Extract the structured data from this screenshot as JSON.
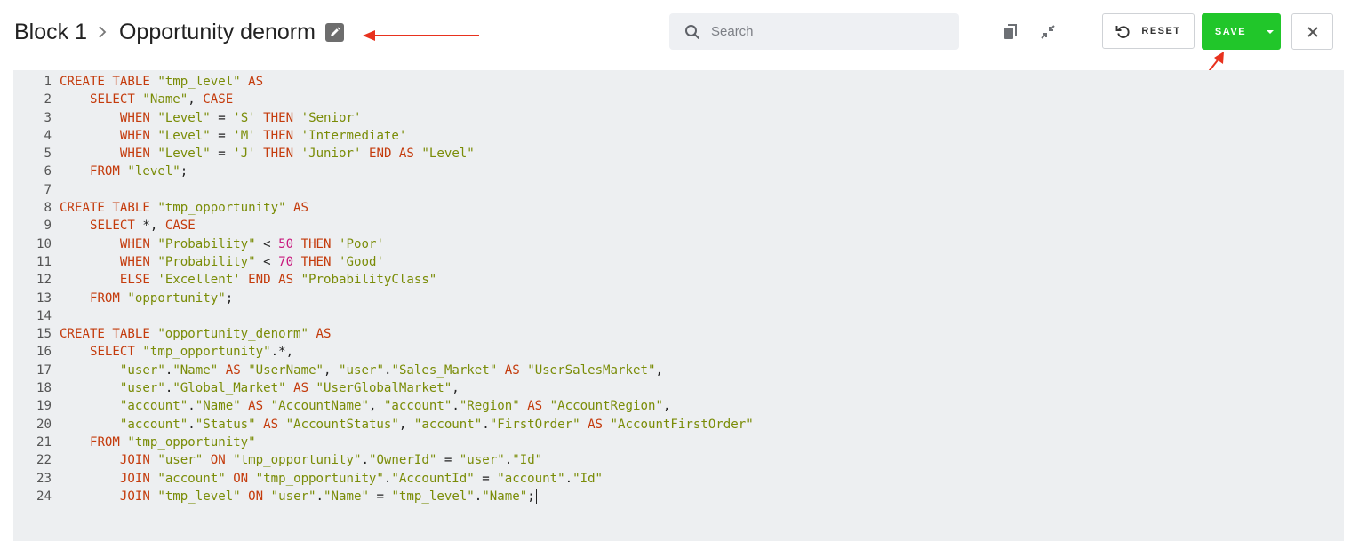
{
  "breadcrumb": {
    "parent": "Block 1",
    "separator": "›",
    "title": "Opportunity denorm"
  },
  "search": {
    "placeholder": "Search",
    "value": ""
  },
  "toolbar": {
    "reset_label": "RESET",
    "save_label": "SAVE"
  },
  "icons": {
    "edit": "pencil-icon",
    "search": "search-icon",
    "copy": "copy-icon",
    "collapse": "collapse-icon",
    "reset": "undo-icon",
    "dropdown": "caret-down-icon",
    "close": "close-icon"
  },
  "colors": {
    "save_green": "#21c62a",
    "keyword": "#c43b0c",
    "string": "#7a8c07",
    "number": "#c8187d",
    "annotation_arrow": "#e8321e",
    "editor_bg": "#edeff1"
  },
  "editor": {
    "lines": [
      [
        [
          "k",
          "CREATE TABLE "
        ],
        [
          "s",
          "\"tmp_level\""
        ],
        [
          "k",
          " AS"
        ]
      ],
      [
        [
          "t",
          "    "
        ],
        [
          "k",
          "SELECT "
        ],
        [
          "s",
          "\"Name\""
        ],
        [
          "t",
          ", "
        ],
        [
          "k",
          "CASE"
        ]
      ],
      [
        [
          "t",
          "        "
        ],
        [
          "k",
          "WHEN "
        ],
        [
          "s",
          "\"Level\""
        ],
        [
          "t",
          " = "
        ],
        [
          "s",
          "'S'"
        ],
        [
          "k",
          " THEN "
        ],
        [
          "s",
          "'Senior'"
        ]
      ],
      [
        [
          "t",
          "        "
        ],
        [
          "k",
          "WHEN "
        ],
        [
          "s",
          "\"Level\""
        ],
        [
          "t",
          " = "
        ],
        [
          "s",
          "'M'"
        ],
        [
          "k",
          " THEN "
        ],
        [
          "s",
          "'Intermediate'"
        ]
      ],
      [
        [
          "t",
          "        "
        ],
        [
          "k",
          "WHEN "
        ],
        [
          "s",
          "\"Level\""
        ],
        [
          "t",
          " = "
        ],
        [
          "s",
          "'J'"
        ],
        [
          "k",
          " THEN "
        ],
        [
          "s",
          "'Junior'"
        ],
        [
          "k",
          " END AS "
        ],
        [
          "s",
          "\"Level\""
        ]
      ],
      [
        [
          "t",
          "    "
        ],
        [
          "k",
          "FROM "
        ],
        [
          "s",
          "\"level\""
        ],
        [
          "t",
          ";"
        ]
      ],
      [],
      [
        [
          "k",
          "CREATE TABLE "
        ],
        [
          "s",
          "\"tmp_opportunity\""
        ],
        [
          "k",
          " AS"
        ]
      ],
      [
        [
          "t",
          "    "
        ],
        [
          "k",
          "SELECT "
        ],
        [
          "t",
          "*, "
        ],
        [
          "k",
          "CASE"
        ]
      ],
      [
        [
          "t",
          "        "
        ],
        [
          "k",
          "WHEN "
        ],
        [
          "s",
          "\"Probability\""
        ],
        [
          "t",
          " < "
        ],
        [
          "n",
          "50"
        ],
        [
          "k",
          " THEN "
        ],
        [
          "s",
          "'Poor'"
        ]
      ],
      [
        [
          "t",
          "        "
        ],
        [
          "k",
          "WHEN "
        ],
        [
          "s",
          "\"Probability\""
        ],
        [
          "t",
          " < "
        ],
        [
          "n",
          "70"
        ],
        [
          "k",
          " THEN "
        ],
        [
          "s",
          "'Good'"
        ]
      ],
      [
        [
          "t",
          "        "
        ],
        [
          "k",
          "ELSE "
        ],
        [
          "s",
          "'Excellent'"
        ],
        [
          "k",
          " END AS "
        ],
        [
          "s",
          "\"ProbabilityClass\""
        ]
      ],
      [
        [
          "t",
          "    "
        ],
        [
          "k",
          "FROM "
        ],
        [
          "s",
          "\"opportunity\""
        ],
        [
          "t",
          ";"
        ]
      ],
      [],
      [
        [
          "k",
          "CREATE TABLE "
        ],
        [
          "s",
          "\"opportunity_denorm\""
        ],
        [
          "k",
          " AS"
        ]
      ],
      [
        [
          "t",
          "    "
        ],
        [
          "k",
          "SELECT "
        ],
        [
          "s",
          "\"tmp_opportunity\""
        ],
        [
          "t",
          ".*,"
        ]
      ],
      [
        [
          "t",
          "        "
        ],
        [
          "s",
          "\"user\""
        ],
        [
          "t",
          "."
        ],
        [
          "s",
          "\"Name\""
        ],
        [
          "k",
          " AS "
        ],
        [
          "s",
          "\"UserName\""
        ],
        [
          "t",
          ", "
        ],
        [
          "s",
          "\"user\""
        ],
        [
          "t",
          "."
        ],
        [
          "s",
          "\"Sales_Market\""
        ],
        [
          "k",
          " AS "
        ],
        [
          "s",
          "\"UserSalesMarket\""
        ],
        [
          "t",
          ","
        ]
      ],
      [
        [
          "t",
          "        "
        ],
        [
          "s",
          "\"user\""
        ],
        [
          "t",
          "."
        ],
        [
          "s",
          "\"Global_Market\""
        ],
        [
          "k",
          " AS "
        ],
        [
          "s",
          "\"UserGlobalMarket\""
        ],
        [
          "t",
          ","
        ]
      ],
      [
        [
          "t",
          "        "
        ],
        [
          "s",
          "\"account\""
        ],
        [
          "t",
          "."
        ],
        [
          "s",
          "\"Name\""
        ],
        [
          "k",
          " AS "
        ],
        [
          "s",
          "\"AccountName\""
        ],
        [
          "t",
          ", "
        ],
        [
          "s",
          "\"account\""
        ],
        [
          "t",
          "."
        ],
        [
          "s",
          "\"Region\""
        ],
        [
          "k",
          " AS "
        ],
        [
          "s",
          "\"AccountRegion\""
        ],
        [
          "t",
          ","
        ]
      ],
      [
        [
          "t",
          "        "
        ],
        [
          "s",
          "\"account\""
        ],
        [
          "t",
          "."
        ],
        [
          "s",
          "\"Status\""
        ],
        [
          "k",
          " AS "
        ],
        [
          "s",
          "\"AccountStatus\""
        ],
        [
          "t",
          ", "
        ],
        [
          "s",
          "\"account\""
        ],
        [
          "t",
          "."
        ],
        [
          "s",
          "\"FirstOrder\""
        ],
        [
          "k",
          " AS "
        ],
        [
          "s",
          "\"AccountFirstOrder\""
        ]
      ],
      [
        [
          "t",
          "    "
        ],
        [
          "k",
          "FROM "
        ],
        [
          "s",
          "\"tmp_opportunity\""
        ]
      ],
      [
        [
          "t",
          "        "
        ],
        [
          "k",
          "JOIN "
        ],
        [
          "s",
          "\"user\""
        ],
        [
          "k",
          " ON "
        ],
        [
          "s",
          "\"tmp_opportunity\""
        ],
        [
          "t",
          "."
        ],
        [
          "s",
          "\"OwnerId\""
        ],
        [
          "t",
          " = "
        ],
        [
          "s",
          "\"user\""
        ],
        [
          "t",
          "."
        ],
        [
          "s",
          "\"Id\""
        ]
      ],
      [
        [
          "t",
          "        "
        ],
        [
          "k",
          "JOIN "
        ],
        [
          "s",
          "\"account\""
        ],
        [
          "k",
          " ON "
        ],
        [
          "s",
          "\"tmp_opportunity\""
        ],
        [
          "t",
          "."
        ],
        [
          "s",
          "\"AccountId\""
        ],
        [
          "t",
          " = "
        ],
        [
          "s",
          "\"account\""
        ],
        [
          "t",
          "."
        ],
        [
          "s",
          "\"Id\""
        ]
      ],
      [
        [
          "t",
          "        "
        ],
        [
          "k",
          "JOIN "
        ],
        [
          "s",
          "\"tmp_level\""
        ],
        [
          "k",
          " ON "
        ],
        [
          "s",
          "\"user\""
        ],
        [
          "t",
          "."
        ],
        [
          "s",
          "\"Name\""
        ],
        [
          "t",
          " = "
        ],
        [
          "s",
          "\"tmp_level\""
        ],
        [
          "t",
          "."
        ],
        [
          "s",
          "\"Name\""
        ],
        [
          "t",
          ";"
        ]
      ]
    ]
  }
}
